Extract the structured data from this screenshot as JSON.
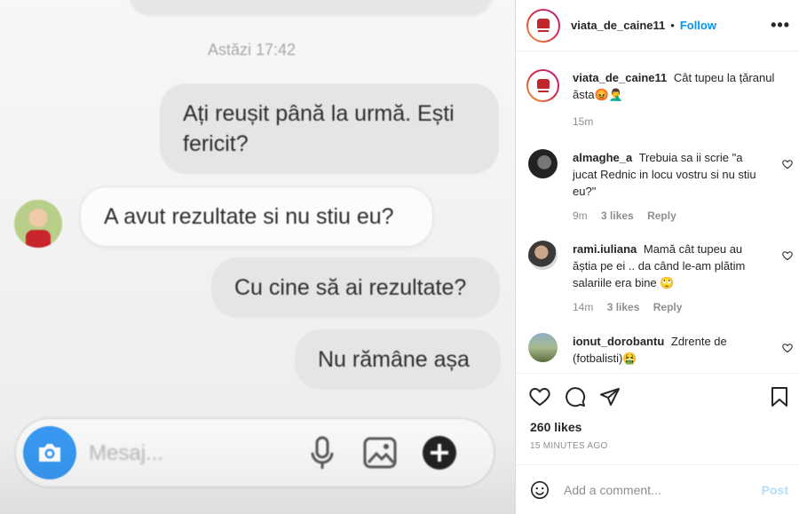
{
  "media": {
    "chat_time": "Astăzi 17:42",
    "messages": [
      {
        "text": "Ați reușit până la urmă. Ești fericit?",
        "side": "out"
      },
      {
        "text": "A avut rezultate si nu stiu eu?",
        "side": "in"
      },
      {
        "text": "Cu cine să ai rezultate?",
        "side": "out"
      },
      {
        "text": "Nu rămâne așa",
        "side": "out"
      }
    ],
    "message_placeholder": "Mesaj..."
  },
  "header": {
    "username": "viata_de_caine11",
    "separator": "•",
    "follow_label": "Follow",
    "more_icon": "more-horizontal-icon"
  },
  "caption": {
    "username": "viata_de_caine11",
    "text": "Cât tupeu la țăranul ăsta😡🤦‍♂️",
    "time": "15m"
  },
  "comments": [
    {
      "username": "almaghe_a",
      "text": "Trebuia sa ii scrie \"a jucat Rednic in locu vostru si nu stiu eu?\"",
      "time": "9m",
      "likes": "3 likes",
      "reply": "Reply"
    },
    {
      "username": "rami.iuliana",
      "text": "Mamă cât tupeu au ăștia pe ei .. da când le-am plătim salariile era bine 🙄",
      "time": "14m",
      "likes": "3 likes",
      "reply": "Reply"
    },
    {
      "username": "ionut_dorobantu",
      "text": "Zdrente de (fotbalisti)🤮",
      "time": "",
      "likes": "",
      "reply": ""
    }
  ],
  "actions": {
    "icons": [
      "heart-icon",
      "comment-icon",
      "share-icon",
      "bookmark-icon"
    ]
  },
  "likes": "260 likes",
  "timestamp": "15 MINUTES AGO",
  "add_comment": {
    "placeholder": "Add a comment...",
    "post_label": "Post"
  },
  "colors": {
    "link_blue": "#0095f6",
    "post_disabled": "#b2dffc",
    "camera_blue": "#3897f0",
    "muted": "#8e8e8e"
  }
}
